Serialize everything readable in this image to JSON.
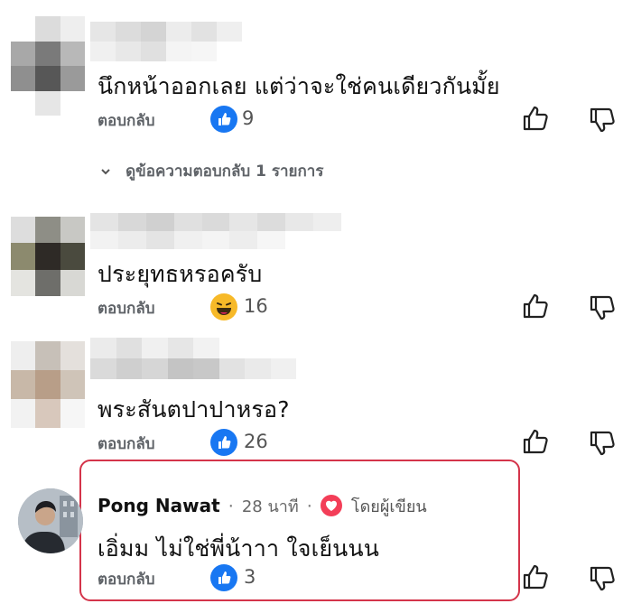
{
  "comments": [
    {
      "text": "นึกหน้าออกเลย แต่ว่าจะใช่คนเดียวกันมั้ย",
      "reply_label": "ตอบกลับ",
      "reaction": "like",
      "reaction_count": "9",
      "view_replies_label": "ดูข้อความตอบกลับ 1 รายการ"
    },
    {
      "text": "ประยุทธหรอครับ",
      "reply_label": "ตอบกลับ",
      "reaction": "haha",
      "reaction_count": "16"
    },
    {
      "text": "พระสันตปาปาหรอ?",
      "reply_label": "ตอบกลับ",
      "reaction": "like",
      "reaction_count": "26"
    },
    {
      "author": "Pong Nawat",
      "time": "28 นาที",
      "separator": "·",
      "author_badge": "โดยผู้เขียน",
      "text": "เอิ่มม ไม่ใช่พี่น้าาา ใจเย็นนน",
      "reply_label": "ตอบกลับ",
      "reaction": "like",
      "reaction_count": "3"
    }
  ],
  "colors": {
    "like_blue": "#1877f2",
    "highlight_red": "#d4344a",
    "muted_text": "#5f6368",
    "haha_yellow": "#f7b928",
    "heart_red": "#f33e58"
  },
  "icons": [
    "thumbs-up-outline-icon",
    "thumbs-down-outline-icon",
    "like-reaction-icon",
    "haha-reaction-icon",
    "heart-icon",
    "chevron-down-icon"
  ]
}
